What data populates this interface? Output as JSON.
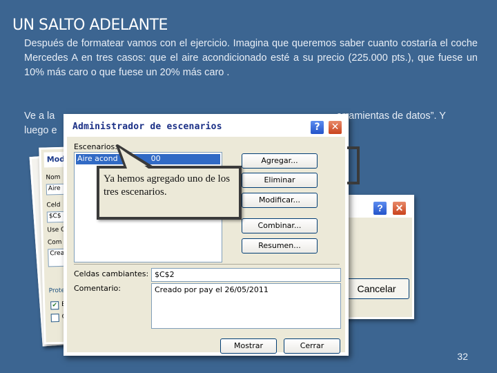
{
  "slide": {
    "title": "UN SALTO ADELANTE",
    "paragraph1": "Después de formatear vamos con el ejercicio. Imagina que queremos saber cuanto costaría el coche Mercedes A en tres casos:  que el aire acondicionado esté a su precio (225.000 pts.), que fuese un 10% más caro o que fuese un 20% más caro .",
    "paragraph2_start": "Ve a la",
    "paragraph2_end": "erramientas de datos”. Y",
    "paragraph2_line2": "luego e",
    "page_number": "32"
  },
  "back_dialog": {
    "title_fragment": "Mod",
    "lines": [
      "Nom",
      "Aire",
      "Celd",
      "$C$",
      "Use C",
      "Com",
      "Crea"
    ],
    "protection": "Protec",
    "check_a": "E",
    "check_b": "O"
  },
  "right_dialog": {
    "help": "?",
    "close": "✕",
    "cancel": "Cancelar"
  },
  "dialog": {
    "title": "Administrador de escenarios",
    "help": "?",
    "close": "✕",
    "scenarios_label": "Escenarios:",
    "scenario_item": "Aire acond",
    "scenario_item_tail": "00",
    "buttons": {
      "add": "Agregar...",
      "delete": "Eliminar",
      "edit": "Modificar...",
      "merge": "Combinar...",
      "summary": "Resumen...",
      "show": "Mostrar",
      "close": "Cerrar"
    },
    "changing_cells_label": "Celdas cambiantes:",
    "changing_cells_value": "$C$2",
    "comment_label": "Comentario:",
    "comment_value": "Creado por pay el 26/05/2011"
  },
  "callout": {
    "text": "Ya hemos agregado uno de los tres escenarios."
  },
  "colors": {
    "background": "#3c6591",
    "dialog_face": "#ece9d8",
    "title_blue": "#1a2f86",
    "selection": "#316ac5"
  }
}
